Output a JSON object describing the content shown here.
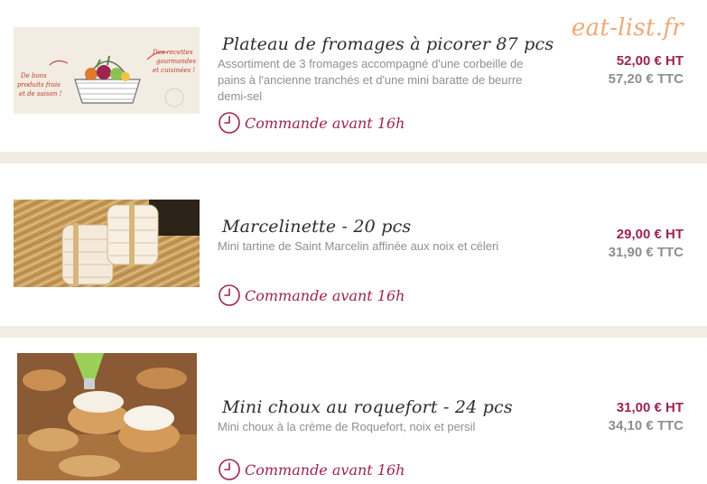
{
  "brand": {
    "watermark": "eat-list.fr"
  },
  "deadline_label": "Commande avant 16h",
  "products": [
    {
      "title": "Plateau de fromages à picorer 87 pcs",
      "description": "Assortiment de 3 fromages accompagné d'une corbeille de pains à l'ancienne tranchés et d'une mini baratte de beurre demi-sel",
      "price_ht": "52,00 € HT",
      "price_ttc": "57,20 € TTC",
      "image": {
        "text_left": [
          "De bons",
          "produits frais",
          "et de saison !"
        ],
        "text_right": [
          "Des recettes",
          "gourmandes",
          "et cuisinées !"
        ]
      }
    },
    {
      "title": "Marcelinette - 20 pcs",
      "description": "Mini tartine de Saint Marcelin affinée aux noix et céleri",
      "price_ht": "29,00 € HT",
      "price_ttc": "31,90 € TTC"
    },
    {
      "title": "Mini choux au roquefort - 24 pcs",
      "description": "Mini choux à la crème de Roquefort, noix et persil",
      "price_ht": "31,00 € HT",
      "price_ttc": "34,10 € TTC"
    }
  ],
  "colors": {
    "accent": "#9c2450",
    "brand_watermark": "#f0a878",
    "muted_text": "#8f8f8f",
    "separator": "#f1ece4"
  }
}
